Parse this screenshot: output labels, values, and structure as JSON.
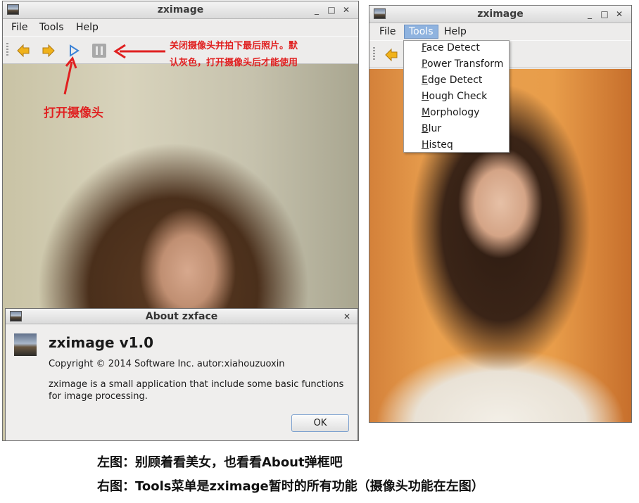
{
  "left_window": {
    "title": "zximage",
    "menu": [
      "File",
      "Tools",
      "Help"
    ],
    "toolbar": {
      "back_icon": "arrow-left-icon",
      "forward_icon": "arrow-right-icon",
      "play_icon": "play-icon",
      "pause_icon": "pause-icon"
    }
  },
  "annotations": {
    "pause_note_line1": "关闭摄像头并拍下最后照片。默",
    "pause_note_line2": "认灰色，打开摄像头后才能使用",
    "play_note": "打开摄像头"
  },
  "about_dialog": {
    "title": "About zxface",
    "heading": "zximage v1.0",
    "copyright": "Copyright © 2014 Software Inc. autor:xiahouzuoxin",
    "description_line1": "zximage is a small application that include some basic functions",
    "description_line2": "for image processing.",
    "ok_label": "OK"
  },
  "right_window": {
    "title": "zximage",
    "menu": [
      "File",
      "Tools",
      "Help"
    ],
    "tools_menu": [
      {
        "mnemonic": "F",
        "rest": "ace Detect"
      },
      {
        "mnemonic": "P",
        "rest": "ower Transform"
      },
      {
        "mnemonic": "E",
        "rest": "dge Detect"
      },
      {
        "mnemonic": "H",
        "rest": "ough Check"
      },
      {
        "mnemonic": "M",
        "rest": "orphology"
      },
      {
        "mnemonic": "B",
        "rest": "lur"
      },
      {
        "mnemonic": "H",
        "rest": "isteq"
      }
    ]
  },
  "captions": {
    "left": "左图：别顾着看美女，也看看About弹框吧",
    "right": "右图：Tools菜单是zximage暂时的所有功能（摄像头功能在左图）"
  },
  "colors": {
    "annotation_red": "#e02020",
    "menu_highlight": "#8fb3df"
  }
}
